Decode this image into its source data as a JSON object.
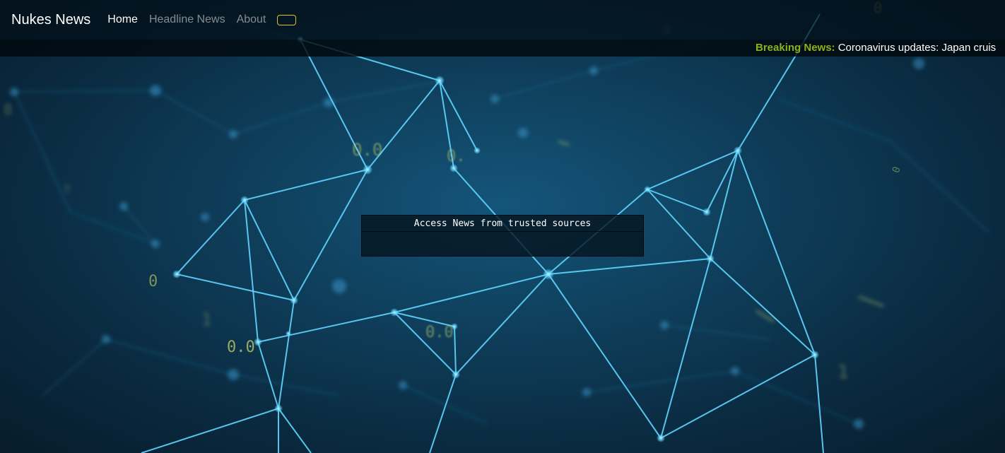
{
  "navbar": {
    "brand": "Nukes News",
    "links": [
      {
        "label": "Home",
        "active": true
      },
      {
        "label": "Headline News",
        "active": false
      },
      {
        "label": "About",
        "active": false
      }
    ]
  },
  "ticker": {
    "label": "Breaking News:",
    "text": "Coronavirus updates: Japan cruis"
  },
  "panel": {
    "heading": "Access News from trusted sources"
  },
  "background": {
    "digits": [
      "0.0",
      "0.",
      "0",
      "0.0",
      "0.0",
      "1",
      "0",
      "0",
      "1",
      "0",
      "0",
      "0"
    ]
  },
  "colors": {
    "ticker_label": "#8ab21a",
    "network_lines": "#5fd6ff",
    "digits": "#c8d36a"
  }
}
